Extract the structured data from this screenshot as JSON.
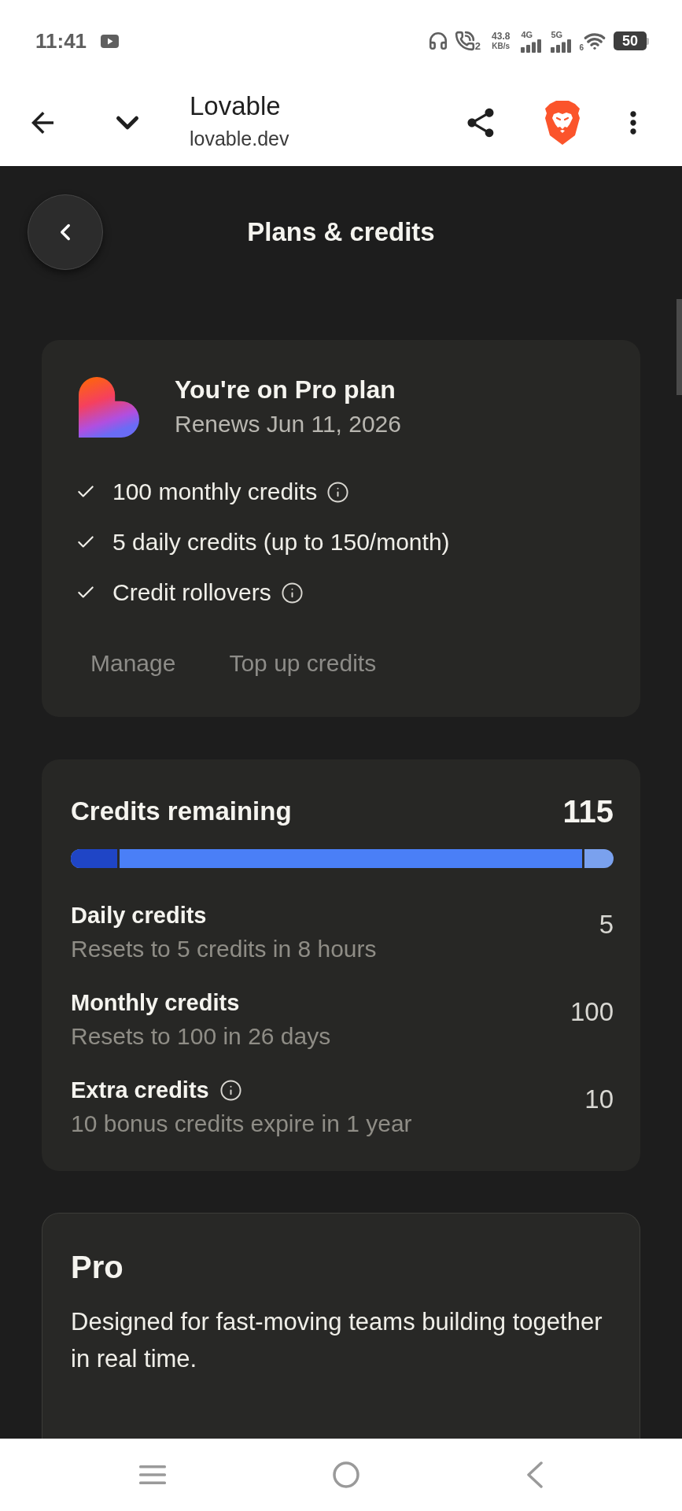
{
  "status_bar": {
    "time": "11:41",
    "call_sim": "2",
    "speed_value": "43.8",
    "speed_unit": "KB/s",
    "network_1": "4G",
    "network_2": "5G",
    "wifi_label": "6",
    "battery": "50"
  },
  "browser_bar": {
    "title": "Lovable",
    "url": "lovable.dev"
  },
  "header": {
    "title": "Plans & credits"
  },
  "plan_card": {
    "title": "You're on Pro plan",
    "subtitle": "Renews Jun 11, 2026",
    "features": [
      {
        "label": "100 monthly credits",
        "info": true
      },
      {
        "label": "5 daily credits (up to 150/month)",
        "info": false
      },
      {
        "label": "Credit rollovers",
        "info": true
      }
    ],
    "actions": [
      {
        "label": "Manage"
      },
      {
        "label": "Top up credits"
      }
    ]
  },
  "credits_card": {
    "title": "Credits remaining",
    "total": "115",
    "segments": [
      {
        "color": "#1f45c6",
        "level": 0.09
      },
      {
        "color": "#4a7ff7",
        "level": 0.946
      },
      {
        "color": "#7aa1ee",
        "level": 1
      }
    ],
    "rows": [
      {
        "label": "Daily credits",
        "info": false,
        "detail": "Resets to 5 credits in 8 hours",
        "value": "5"
      },
      {
        "label": "Monthly credits",
        "info": false,
        "detail": "Resets to 100 in 26 days",
        "value": "100"
      },
      {
        "label": "Extra credits",
        "info": true,
        "detail": "10 bonus credits expire in 1 year",
        "value": "10"
      }
    ]
  },
  "pro_card": {
    "title": "Pro",
    "description": "Designed for fast-moving teams building together in real time."
  }
}
